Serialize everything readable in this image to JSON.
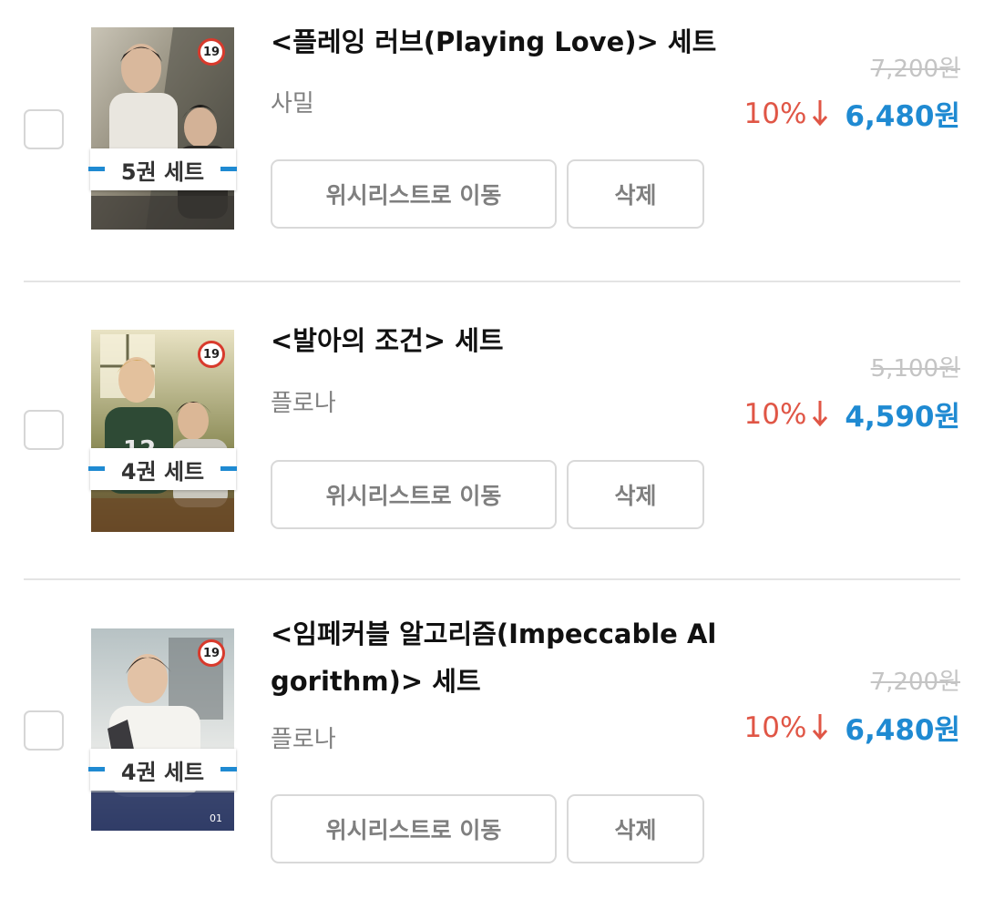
{
  "colors": {
    "accent_blue": "#1f8ad2",
    "discount_red": "#e05646",
    "rating_red": "#d83a2c",
    "muted_gray": "#808080"
  },
  "items": [
    {
      "title": "<플레잉 러브(Playing Love)> 세트",
      "author": "사밀",
      "set_badge": "5권 세트",
      "rating": "19",
      "original_price": "7,200원",
      "discount": "10%",
      "price": "6,480원",
      "wishlist_button": "위시리스트로 이동",
      "delete_button": "삭제",
      "cover_icon": "book-cover-image"
    },
    {
      "title": "<발아의 조건> 세트",
      "author": "플로나",
      "set_badge": "4권 세트",
      "rating": "19",
      "original_price": "5,100원",
      "discount": "10%",
      "price": "4,590원",
      "wishlist_button": "위시리스트로 이동",
      "delete_button": "삭제",
      "cover_icon": "book-cover-image"
    },
    {
      "title": "<임페커블 알고리즘(Impeccable Algorithm)> 세트",
      "author": "플로나",
      "set_badge": "4권 세트",
      "rating": "19",
      "original_price": "7,200원",
      "discount": "10%",
      "price": "6,480원",
      "wishlist_button": "위시리스트로 이동",
      "delete_button": "삭제",
      "cover_icon": "book-cover-image"
    }
  ]
}
